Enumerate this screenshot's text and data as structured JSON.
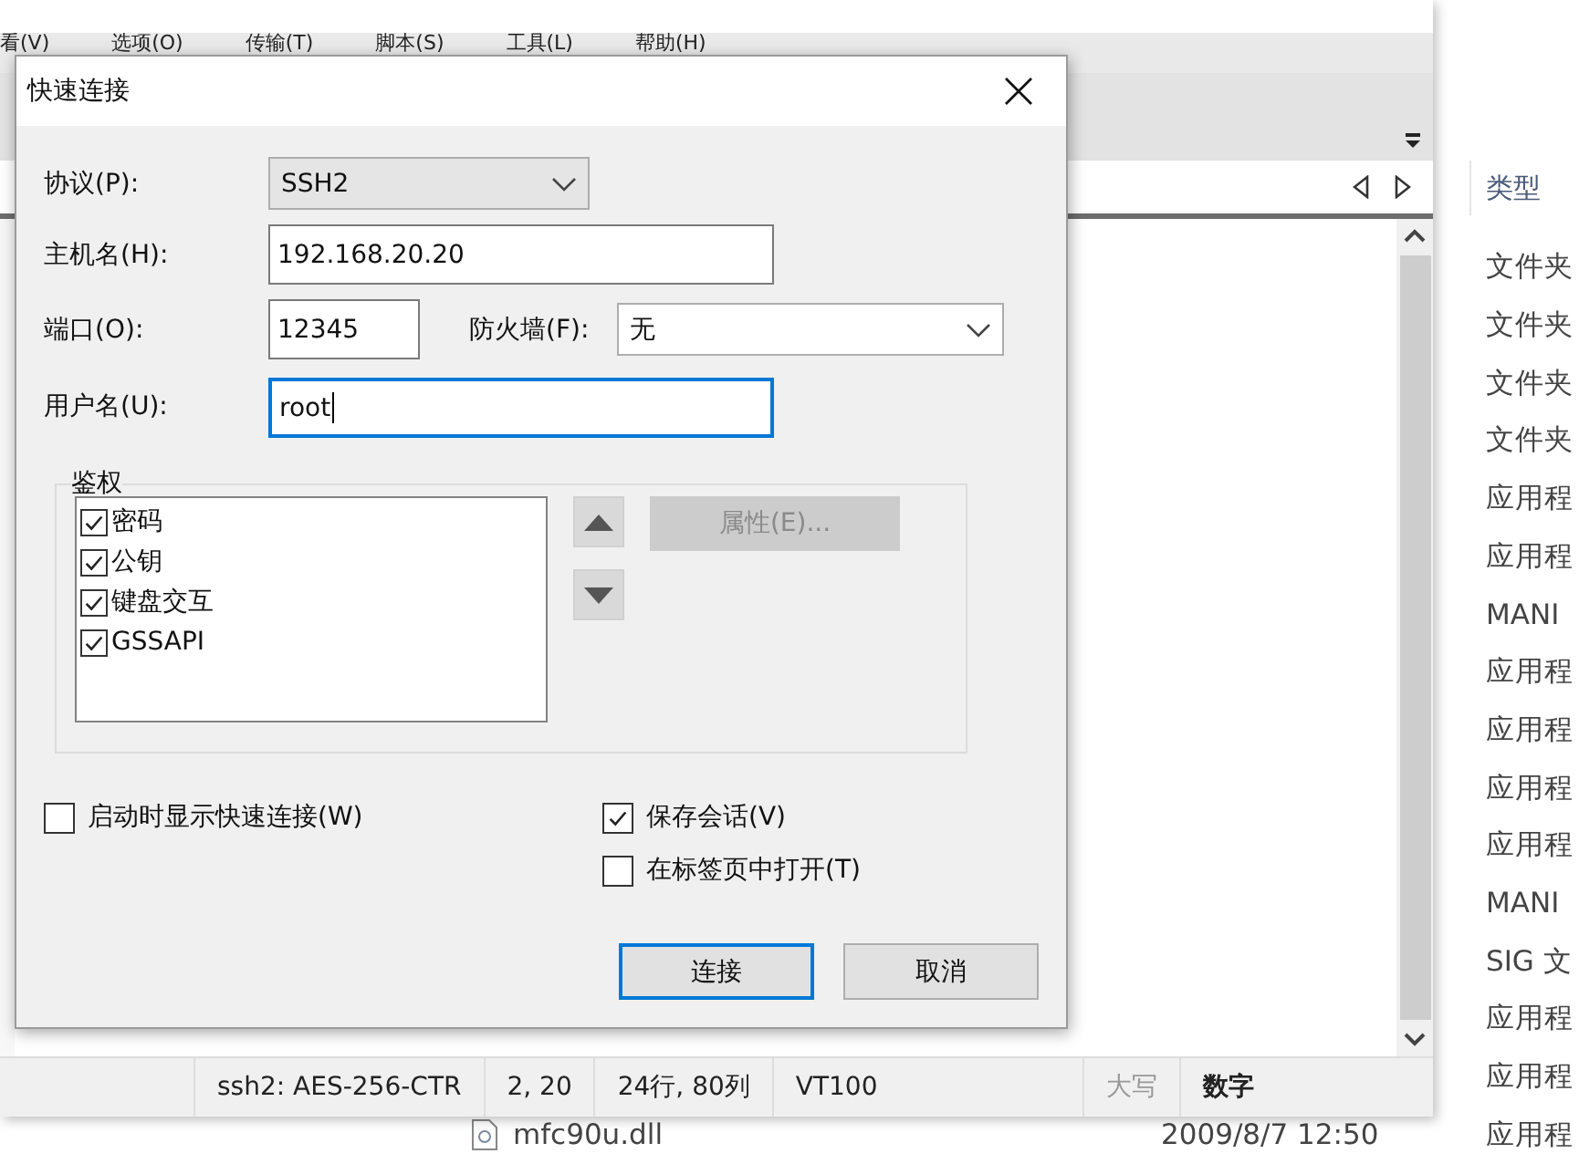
{
  "explorer": {
    "header": "类型",
    "rows": [
      {
        "type": "文件夹"
      },
      {
        "type": "文件夹"
      },
      {
        "type": "文件夹"
      },
      {
        "type": "文件夹"
      },
      {
        "type": "应用程"
      },
      {
        "type": "应用程"
      },
      {
        "type": "MANI"
      },
      {
        "type": "应用程"
      },
      {
        "type": "应用程"
      },
      {
        "type": "应用程"
      },
      {
        "type": "应用程"
      },
      {
        "type": "MANI"
      },
      {
        "type": "SIG 文"
      },
      {
        "type": "应用程"
      },
      {
        "type": "应用程"
      },
      {
        "type": "应用程",
        "name": "mfc90u.dll",
        "date": "2009/8/7 12:50"
      }
    ]
  },
  "terminal_window": {
    "menu": [
      "看(V)",
      "选项(O)",
      "传输(T)",
      "脚本(S)",
      "工具(L)",
      "帮助(H)"
    ],
    "status_bar": [
      {
        "text": "ssh2: AES-256-CTR",
        "on": true
      },
      {
        "text": "2,  20",
        "on": true
      },
      {
        "text": "24行, 80列",
        "on": true
      },
      {
        "text": "VT100",
        "on": true
      },
      {
        "text": "大写",
        "on": false
      },
      {
        "text": "数字",
        "on": true
      }
    ]
  },
  "dialog": {
    "title": "快速连接",
    "protocol": {
      "label": "协议(P):",
      "value": "SSH2"
    },
    "hostname": {
      "label": "主机名(H):",
      "value": "192.168.20.20"
    },
    "port": {
      "label": "端口(O):",
      "value": "12345"
    },
    "firewall": {
      "label": "防火墙(F):",
      "value": "无"
    },
    "username": {
      "label": "用户名(U):",
      "value": "root",
      "focused": true
    },
    "auth": {
      "title": "鉴权",
      "methods": [
        {
          "label": "密码",
          "checked": true
        },
        {
          "label": "公钥",
          "checked": true
        },
        {
          "label": "键盘交互",
          "checked": true
        },
        {
          "label": "GSSAPI",
          "checked": true
        }
      ],
      "properties_button": {
        "label": "属性(E)...",
        "disabled": true
      }
    },
    "options": [
      {
        "label": "启动时显示快速连接(W)",
        "checked": false
      },
      {
        "label": "保存会话(V)",
        "checked": true
      },
      {
        "label": "在标签页中打开(T)",
        "checked": false
      }
    ],
    "buttons": [
      {
        "label": "连接",
        "default": true
      },
      {
        "label": "取消",
        "default": false
      }
    ]
  }
}
